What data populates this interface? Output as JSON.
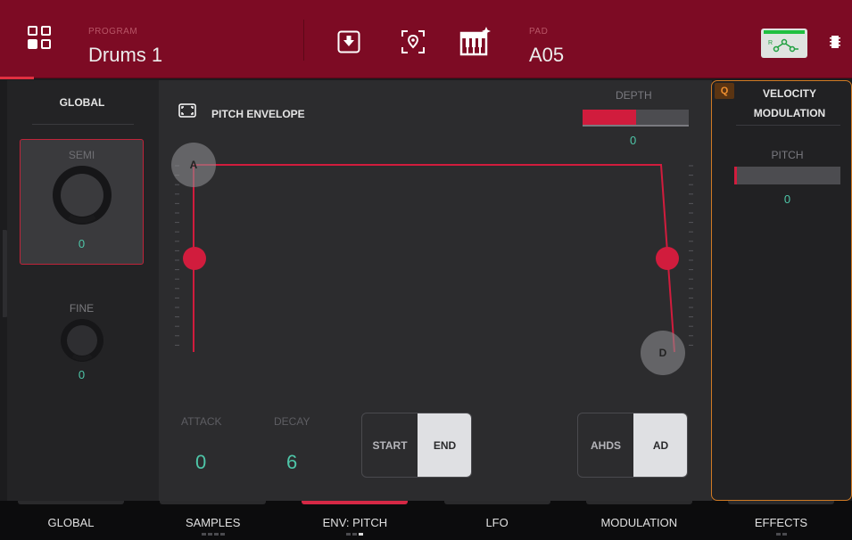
{
  "header": {
    "program_label": "PROGRAM",
    "program_name": "Drums 1",
    "pad_label": "PAD",
    "pad_name": "A05",
    "icons": [
      "grid-menu-icon",
      "download-icon",
      "locate-icon",
      "keyboard-icon",
      "routing-icon",
      "chip-icon"
    ],
    "accent_color": "#7d0b24"
  },
  "left": {
    "title": "GLOBAL",
    "semi_label": "SEMI",
    "semi_value": "0",
    "fine_label": "FINE",
    "fine_value": "0"
  },
  "main": {
    "title": "PITCH ENVELOPE",
    "depth_label": "DEPTH",
    "depth_value": "0",
    "depth_fill_fraction": 0.5,
    "attack_node_label": "A",
    "decay_node_label": "D",
    "attack_label": "ATTACK",
    "attack_value": "0",
    "decay_label": "DECAY",
    "decay_value": "6",
    "start_label": "START",
    "end_label": "END",
    "ahds_label": "AHDS",
    "ad_label": "AD"
  },
  "right": {
    "q_badge": "Q",
    "title_line1": "VELOCITY",
    "title_line2": "MODULATION",
    "pitch_label": "PITCH",
    "pitch_value": "0"
  },
  "tabs": [
    {
      "label": "GLOBAL",
      "active": false,
      "dots": 0
    },
    {
      "label": "SAMPLES",
      "active": false,
      "dots": 4
    },
    {
      "label": "ENV: PITCH",
      "active": true,
      "dots": 3,
      "current_dot": 2
    },
    {
      "label": "LFO",
      "active": false,
      "dots": 0
    },
    {
      "label": "MODULATION",
      "active": false,
      "dots": 0
    },
    {
      "label": "EFFECTS",
      "active": false,
      "dots": 2
    }
  ],
  "colors": {
    "accent_red": "#d11c3d",
    "teal_value": "#4ec6a8",
    "orange_border": "#d07a24"
  }
}
